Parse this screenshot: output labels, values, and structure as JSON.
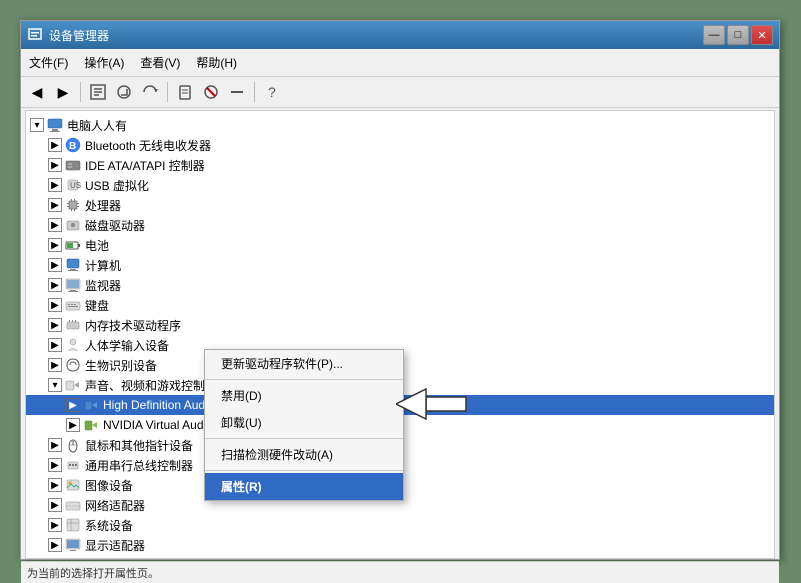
{
  "window": {
    "title": "设备管理器",
    "titleBtn": {
      "minimize": "—",
      "maximize": "□",
      "close": "✕"
    }
  },
  "menubar": {
    "items": [
      {
        "label": "文件(F)"
      },
      {
        "label": "操作(A)"
      },
      {
        "label": "查看(V)"
      },
      {
        "label": "帮助(H)"
      }
    ]
  },
  "tree": {
    "root": "电脑人人有",
    "items": [
      {
        "id": "bluetooth",
        "label": "Bluetooth 无线电收发器",
        "level": 2,
        "expandable": true
      },
      {
        "id": "ide",
        "label": "IDE ATA/ATAPI 控制器",
        "level": 2,
        "expandable": true
      },
      {
        "id": "usb-virtual",
        "label": "USB 虚拟化",
        "level": 2,
        "expandable": true
      },
      {
        "id": "cpu",
        "label": "处理器",
        "level": 2,
        "expandable": true
      },
      {
        "id": "disk",
        "label": "磁盘驱动器",
        "level": 2,
        "expandable": true
      },
      {
        "id": "battery",
        "label": "电池",
        "level": 2,
        "expandable": true
      },
      {
        "id": "computer",
        "label": "计算机",
        "level": 2,
        "expandable": true
      },
      {
        "id": "monitor",
        "label": "监视器",
        "level": 2,
        "expandable": true
      },
      {
        "id": "keyboard",
        "label": "键盘",
        "level": 2,
        "expandable": true
      },
      {
        "id": "memory",
        "label": "内存技术驱动程序",
        "level": 2,
        "expandable": true
      },
      {
        "id": "human",
        "label": "人体学输入设备",
        "level": 2,
        "expandable": true
      },
      {
        "id": "biometric",
        "label": "生物识别设备",
        "level": 2,
        "expandable": true
      },
      {
        "id": "audio-ctrl",
        "label": "声音、视频和游戏控制器",
        "level": 2,
        "expandable": true,
        "expanded": true
      },
      {
        "id": "hd-audio",
        "label": "High Definition Audio ",
        "level": 3,
        "expandable": true,
        "selected": true
      },
      {
        "id": "nvidia-audio",
        "label": "NVIDIA Virtual Audio D",
        "level": 3,
        "expandable": true
      },
      {
        "id": "mouse",
        "label": "鼠标和其他指针设备",
        "level": 2,
        "expandable": true
      },
      {
        "id": "serial",
        "label": "通用串行总线控制器",
        "level": 2,
        "expandable": true
      },
      {
        "id": "image",
        "label": "图像设备",
        "level": 2,
        "expandable": true
      },
      {
        "id": "network",
        "label": "网络适配器",
        "level": 2,
        "expandable": true
      },
      {
        "id": "system",
        "label": "系统设备",
        "level": 2,
        "expandable": true
      },
      {
        "id": "display",
        "label": "显示适配器",
        "level": 2,
        "expandable": true
      }
    ]
  },
  "context_menu": {
    "items": [
      {
        "id": "update-driver",
        "label": "更新驱动程序软件(P)..."
      },
      {
        "id": "disable",
        "label": "禁用(D)"
      },
      {
        "id": "uninstall",
        "label": "卸载(U)"
      },
      {
        "id": "scan",
        "label": "扫描检测硬件改动(A)"
      },
      {
        "id": "properties",
        "label": "属性(R)",
        "selected": true
      }
    ]
  },
  "status_bar": {
    "text": "为当前的选择打开属性页。"
  }
}
